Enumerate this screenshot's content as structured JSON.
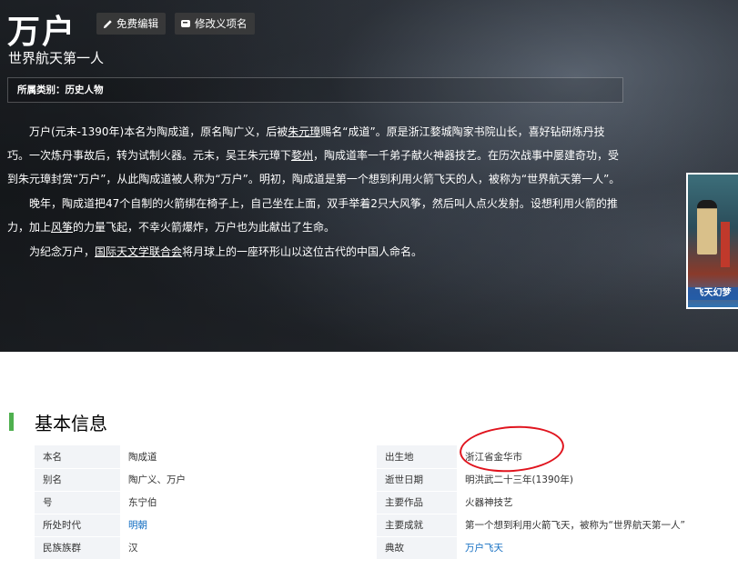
{
  "hero": {
    "title": "万户",
    "edit_button": "免费编辑",
    "rename_button": "修改义项名",
    "subtitle": "世界航天第一人",
    "category_label": "所属类别：",
    "category_value": "历史人物",
    "intro": {
      "p1_a": "万户(元末-1390年)本名为陶成道，原名陶广义，后被",
      "p1_link": "朱元璋",
      "p1_b": "赐名“成道”。原是浙江婺城陶家书院山长，喜好钻研炼丹技巧。一次炼丹事故后，转为试制火器。元末，吴王朱元璋下",
      "p1_link2": "婺州",
      "p1_c": "，陶成道率一千弟子献火神器技艺。在历次战事中屡建奇功，受到朱元璋封赏“万户”，从此陶成道被人称为“万户”。明初，陶成道是第一个想到利用火箭飞天的人，被称为“世界航天第一人”。",
      "p2_a": "晚年，陶成道把47个自制的火箭绑在椅子上，自己坐在上面，双手举着2只大风筝，然后叫人点火发射。设想利用火箭的推力，加上",
      "p2_link": "风筝",
      "p2_b": "的力量飞起，不幸火箭爆炸，万户也为此献出了生命。",
      "p3_a": "为纪念万户，",
      "p3_link": "国际天文学联合会",
      "p3_b": "将月球上的一座环形山以这位古代的中国人命名。"
    },
    "side_image_caption": "飞天幻梦"
  },
  "basic_info": {
    "section_title": "基本信息",
    "rows": [
      {
        "k1": "本名",
        "v1": "陶成道",
        "k2": "出生地",
        "v2": "浙江省金华市"
      },
      {
        "k1": "别名",
        "v1": "陶广义、万户",
        "k2": "逝世日期",
        "v2": "明洪武二十三年(1390年)"
      },
      {
        "k1": "号",
        "v1": "东宁伯",
        "k2": "主要作品",
        "v2": "火器神技艺"
      },
      {
        "k1": "所处时代",
        "v1": "明朝",
        "k2": "主要成就",
        "v2": "第一个想到利用火箭飞天，被称为“世界航天第一人”"
      },
      {
        "k1": "民族族群",
        "v1": "汉",
        "k2": "典故",
        "v2": "万户飞天"
      }
    ]
  },
  "colors": {
    "accent_green": "#4fb04f",
    "link_blue": "#136ec2",
    "annotation_red": "#e0141e"
  }
}
